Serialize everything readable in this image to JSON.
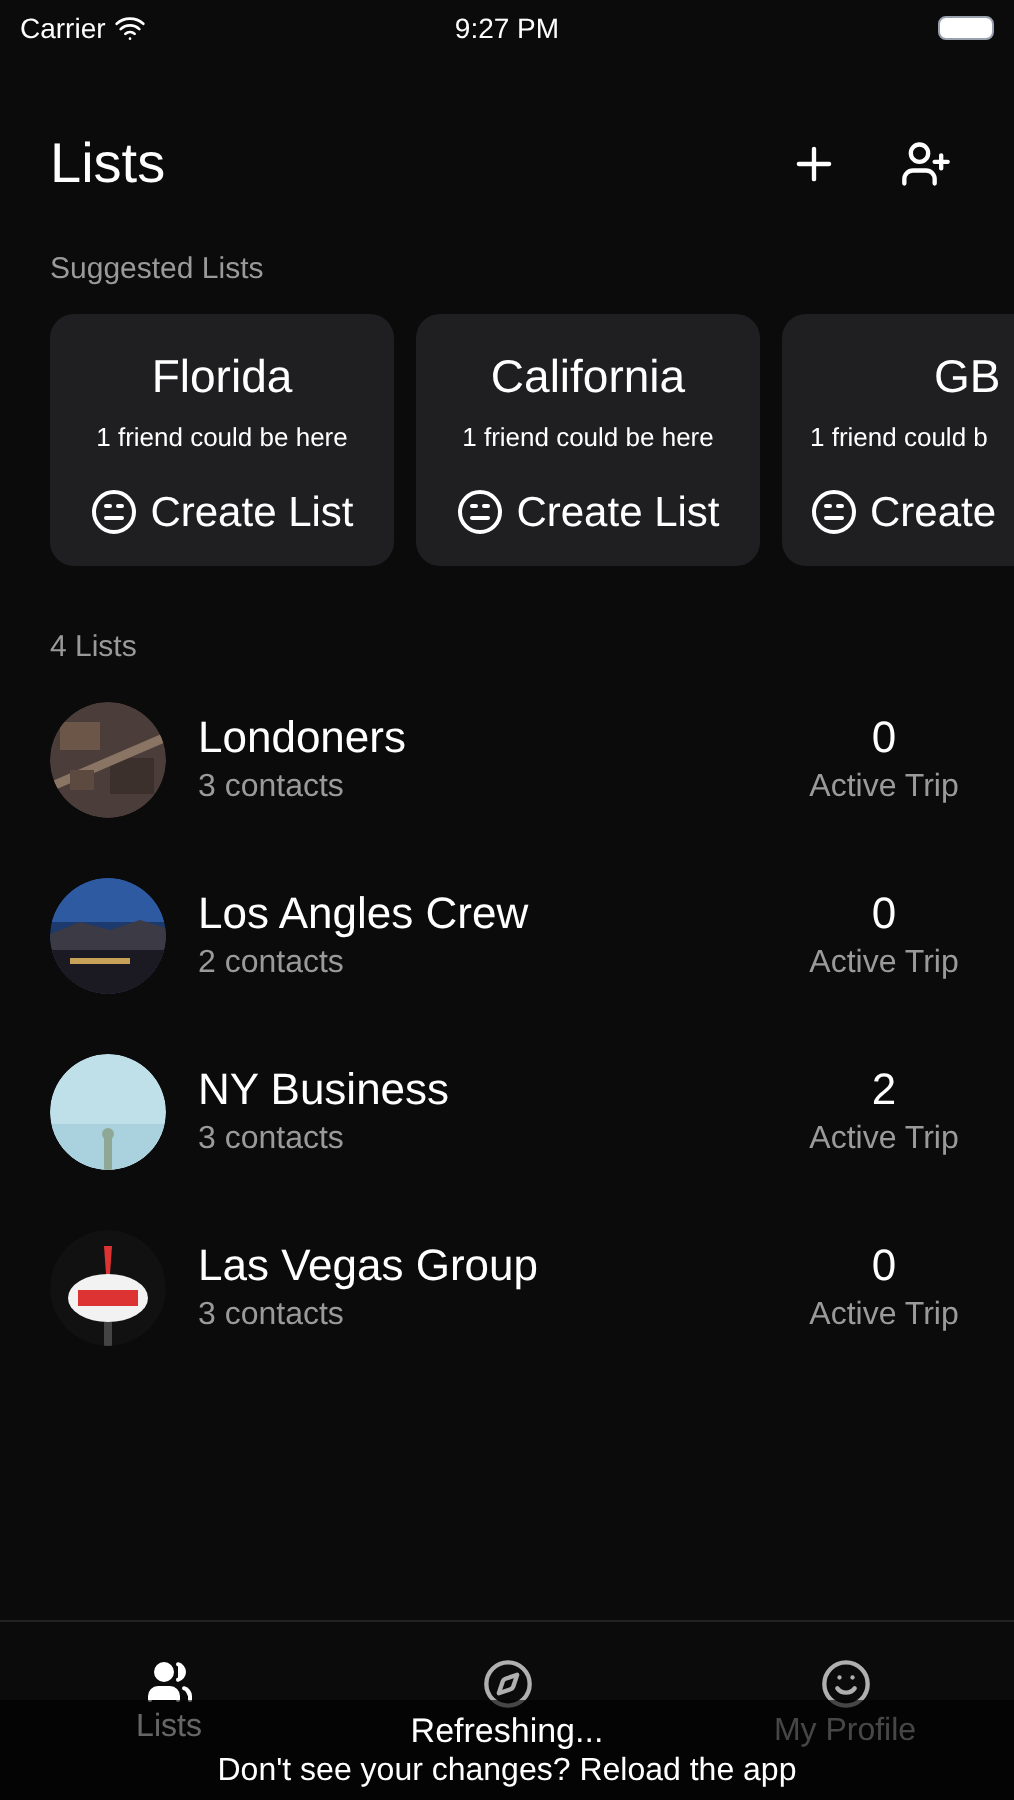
{
  "status_bar": {
    "carrier": "Carrier",
    "time": "9:27 PM"
  },
  "header": {
    "title": "Lists"
  },
  "suggested": {
    "heading": "Suggested Lists",
    "cards": [
      {
        "title": "Florida",
        "subtitle": "1 friend could be here",
        "action": "Create List"
      },
      {
        "title": "California",
        "subtitle": "1 friend could be here",
        "action": "Create List"
      },
      {
        "title": "GB",
        "subtitle": "1 friend could b",
        "action": "Create"
      }
    ]
  },
  "lists": {
    "heading": "4 Lists",
    "rows": [
      {
        "name": "Londoners",
        "contacts": "3 contacts",
        "count": "0",
        "count_label": "Active Trip"
      },
      {
        "name": "Los Angles Crew",
        "contacts": "2 contacts",
        "count": "0",
        "count_label": "Active Trip"
      },
      {
        "name": "NY Business",
        "contacts": "3 contacts",
        "count": "2",
        "count_label": "Active Trip"
      },
      {
        "name": "Las Vegas Group",
        "contacts": "3 contacts",
        "count": "0",
        "count_label": "Active Trip"
      }
    ]
  },
  "tab_bar": [
    {
      "kind": "lists",
      "label": "Lists",
      "selected": true
    },
    {
      "kind": "explore",
      "selected": false
    },
    {
      "kind": "profile",
      "label": "My Profile",
      "selected": false
    }
  ],
  "toast": {
    "title": "Refreshing...",
    "message": "Don't see your changes? Reload the app"
  }
}
